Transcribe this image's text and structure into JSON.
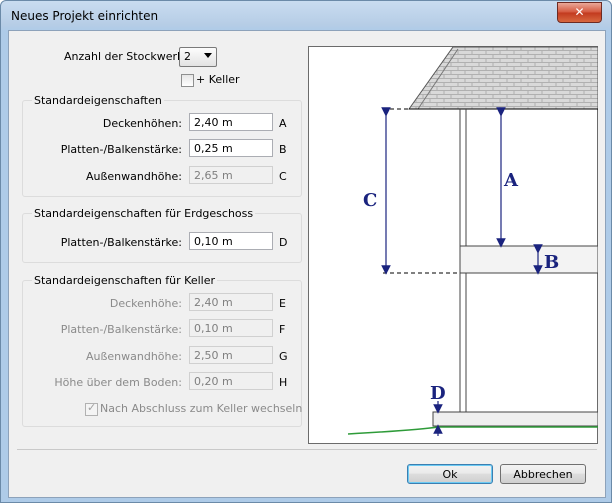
{
  "window": {
    "title": "Neues Projekt einrichten",
    "close_label": "✕"
  },
  "floors": {
    "label": "Anzahl der Stockwerke",
    "value": "2",
    "keller_label": "+ Keller",
    "keller_checked": false
  },
  "standard": {
    "title": "Standardeigenschaften",
    "rows": [
      {
        "label": "Deckenhöhen:",
        "value": "2,40 m",
        "letter": "A",
        "enabled": true
      },
      {
        "label": "Platten-/Balkenstärke:",
        "value": "0,25 m",
        "letter": "B",
        "enabled": true
      },
      {
        "label": "Außenwandhöhe:",
        "value": "2,65 m",
        "letter": "C",
        "enabled": false
      }
    ]
  },
  "ground": {
    "title": "Standardeigenschaften für Erdgeschoss",
    "rows": [
      {
        "label": "Platten-/Balkenstärke:",
        "value": "0,10 m",
        "letter": "D",
        "enabled": true
      }
    ]
  },
  "keller": {
    "title": "Standardeigenschaften für Keller",
    "rows": [
      {
        "label": "Deckenhöhe:",
        "value": "2,40 m",
        "letter": "E"
      },
      {
        "label": "Platten-/Balkenstärke:",
        "value": "0,10 m",
        "letter": "F"
      },
      {
        "label": "Außenwandhöhe:",
        "value": "2,50 m",
        "letter": "G"
      },
      {
        "label": "Höhe über dem Boden:",
        "value": "0,20 m",
        "letter": "H"
      }
    ],
    "switch_label": "Nach Abschluss zum Keller wechseln",
    "switch_checked": true
  },
  "diagram": {
    "labels": {
      "a": "A",
      "b": "B",
      "c": "C",
      "d": "D"
    }
  },
  "buttons": {
    "ok": "Ok",
    "cancel": "Abbrechen"
  }
}
